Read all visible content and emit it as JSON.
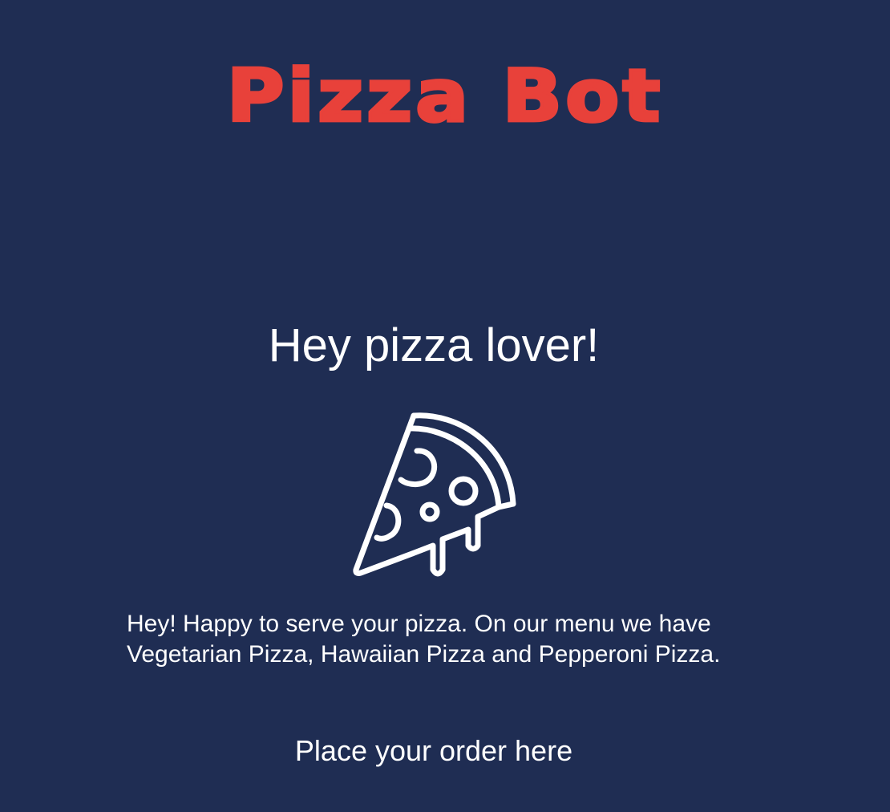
{
  "header": {
    "title": "Pizza Bot"
  },
  "main": {
    "greeting": "Hey pizza lover!",
    "illustration_icon": "pizza-slice-icon",
    "intro": "Hey! Happy to serve your pizza. On our menu we have Vegetarian Pizza, Hawaiian Pizza and Pepperoni Pizza.",
    "order_link_label": "Place your order here"
  },
  "colors": {
    "background": "#1f2d53",
    "brand": "#e8413a",
    "text": "#ffffff"
  }
}
